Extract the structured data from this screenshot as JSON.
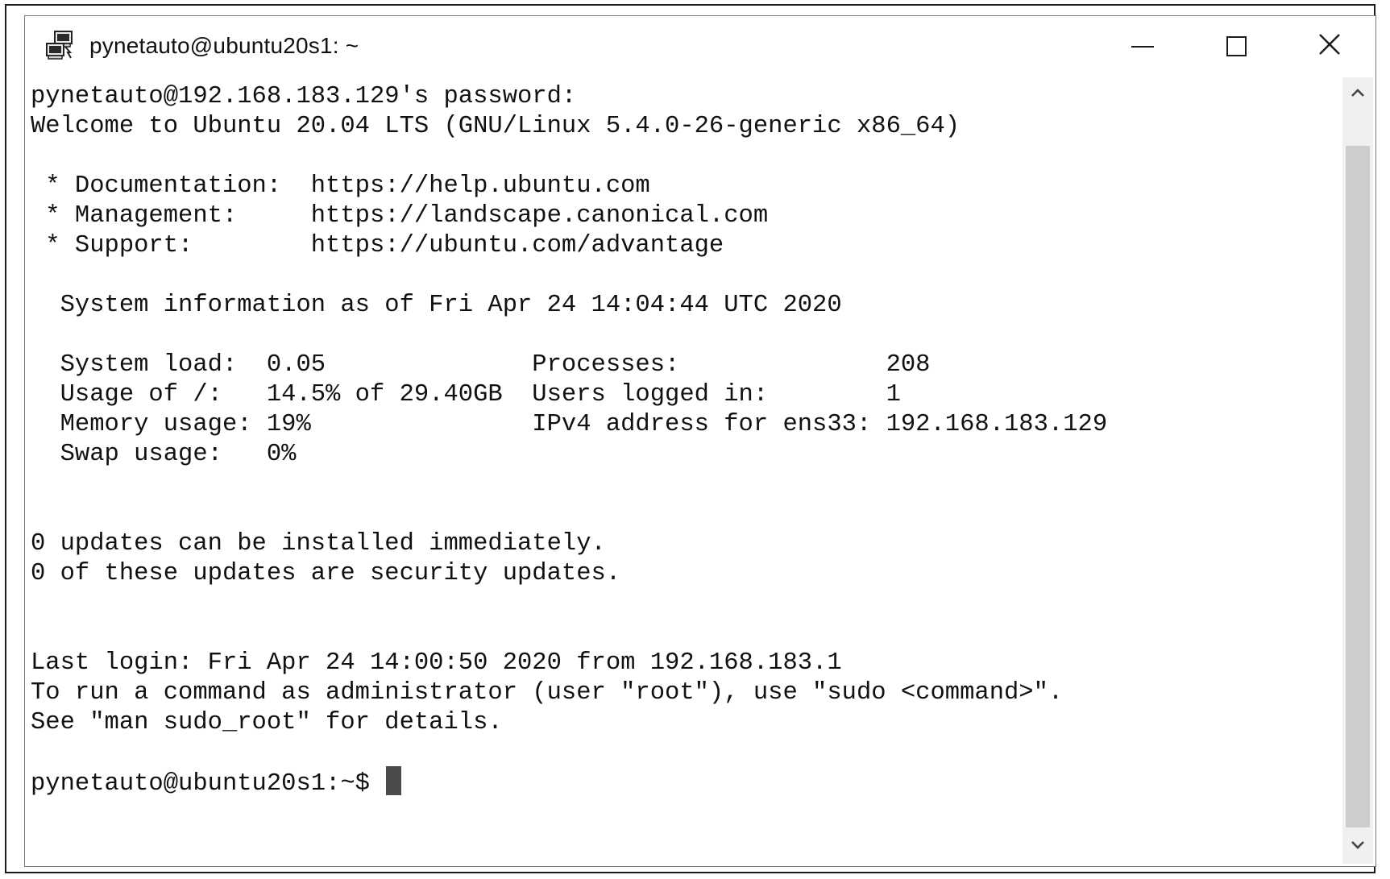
{
  "window": {
    "title": "pynetauto@ubuntu20s1: ~",
    "icon": "putty-terminal-icon",
    "controls": {
      "minimize": "minimize-icon",
      "maximize": "maximize-icon",
      "close": "close-icon"
    }
  },
  "terminal": {
    "lines": [
      "pynetauto@192.168.183.129's password:",
      "Welcome to Ubuntu 20.04 LTS (GNU/Linux 5.4.0-26-generic x86_64)",
      "",
      " * Documentation:  https://help.ubuntu.com",
      " * Management:     https://landscape.canonical.com",
      " * Support:        https://ubuntu.com/advantage",
      "",
      "  System information as of Fri Apr 24 14:04:44 UTC 2020",
      "",
      "  System load:  0.05              Processes:              208",
      "  Usage of /:   14.5% of 29.40GB  Users logged in:        1",
      "  Memory usage: 19%               IPv4 address for ens33: 192.168.183.129",
      "  Swap usage:   0%",
      "",
      "",
      "0 updates can be installed immediately.",
      "0 of these updates are security updates.",
      "",
      "",
      "Last login: Fri Apr 24 14:00:50 2020 from 192.168.183.1",
      "To run a command as administrator (user \"root\"), use \"sudo <command>\".",
      "See \"man sudo_root\" for details.",
      "",
      "pynetauto@ubuntu20s1:~$ "
    ]
  },
  "scrollbar": {
    "up": "chevron-up-icon",
    "down": "chevron-down-icon"
  }
}
